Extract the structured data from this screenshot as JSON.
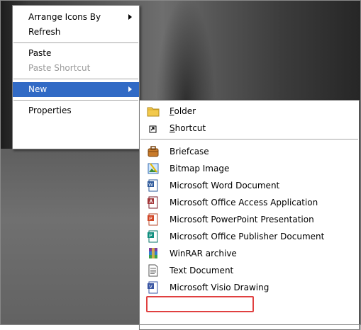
{
  "context_menu": {
    "items": [
      {
        "label": "Arrange Icons By",
        "has_submenu": true,
        "disabled": false
      },
      {
        "label": "Refresh",
        "has_submenu": false,
        "disabled": false
      },
      {
        "label": "Paste",
        "has_submenu": false,
        "disabled": false
      },
      {
        "label": "Paste Shortcut",
        "has_submenu": false,
        "disabled": true
      },
      {
        "label": "New",
        "has_submenu": true,
        "disabled": false,
        "selected": true
      },
      {
        "label": "Properties",
        "has_submenu": false,
        "disabled": false
      }
    ]
  },
  "new_submenu": {
    "items": [
      {
        "label_prefix": "",
        "underline_char": "F",
        "label_rest": "older",
        "icon": "folder-icon"
      },
      {
        "label_prefix": "",
        "underline_char": "S",
        "label_rest": "hortcut",
        "icon": "shortcut-icon"
      },
      {
        "label": "Briefcase",
        "icon": "briefcase-icon"
      },
      {
        "label": "Bitmap Image",
        "icon": "bitmap-image-icon"
      },
      {
        "label": "Microsoft Word Document",
        "icon": "word-document-icon"
      },
      {
        "label": "Microsoft Office Access Application",
        "icon": "access-application-icon"
      },
      {
        "label": "Microsoft PowerPoint Presentation",
        "icon": "powerpoint-presentation-icon"
      },
      {
        "label": "Microsoft Office Publisher Document",
        "icon": "publisher-document-icon"
      },
      {
        "label": "WinRAR archive",
        "icon": "winrar-archive-icon"
      },
      {
        "label": "Text Document",
        "icon": "text-document-icon",
        "highlighted": true
      },
      {
        "label": "Microsoft Visio Drawing",
        "icon": "visio-drawing-icon"
      }
    ]
  },
  "colors": {
    "selection": "#316ac5",
    "highlight_border": "#e04040",
    "disabled_text": "#9a9a9a"
  }
}
